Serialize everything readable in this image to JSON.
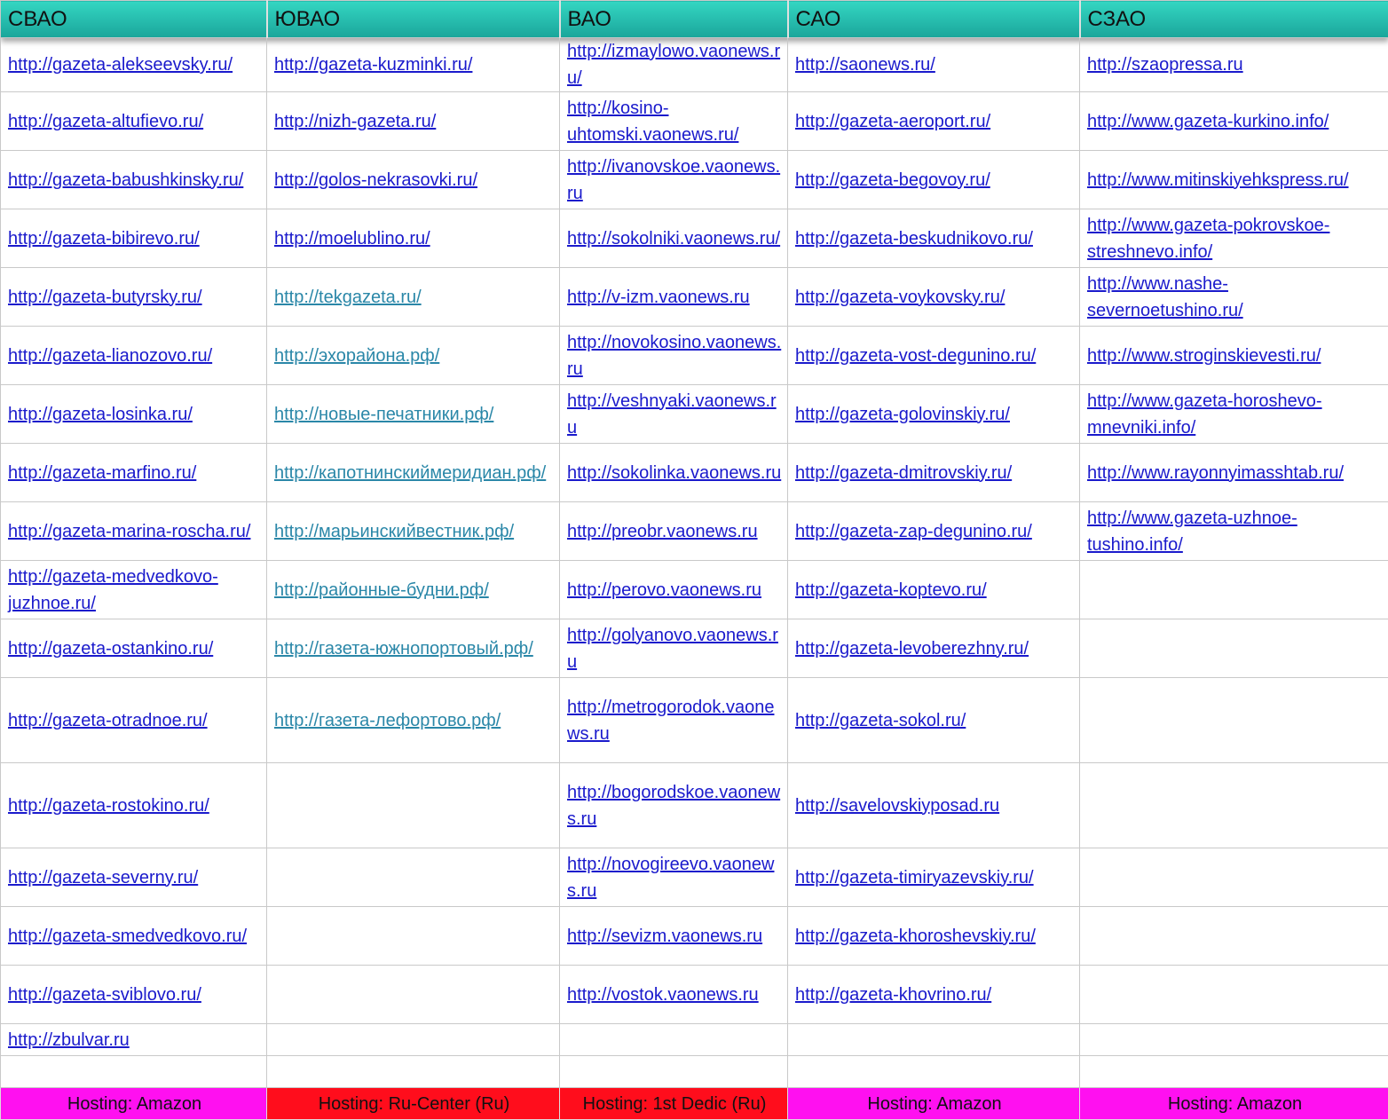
{
  "headers": [
    "СВАО",
    "ЮВАО",
    "ВАО",
    "САО",
    "СЗАО"
  ],
  "rows": [
    [
      "http://gazeta-alekseevsky.ru/",
      "http://gazeta-kuzminki.ru/",
      "http://izmaylowo.vaonews.ru/",
      "http://saonews.ru/",
      "http://szaopressa.ru"
    ],
    [
      "http://gazeta-altufievo.ru/",
      "http://nizh-gazeta.ru/",
      "http://kosino-uhtomski.vaonews.ru/",
      "http://gazeta-aeroport.ru/",
      "http://www.gazeta-kurkino.info/"
    ],
    [
      "http://gazeta-babushkinsky.ru/",
      "http://golos-nekrasovki.ru/",
      "http://ivanovskoe.vaonews.ru",
      "http://gazeta-begovoy.ru/",
      "http://www.mitinskiyehkspress.ru/"
    ],
    [
      "http://gazeta-bibirevo.ru/",
      "http://moelublino.ru/",
      "http://sokolniki.vaonews.ru/",
      "http://gazeta-beskudnikovo.ru/",
      "http://www.gazeta-pokrovskoe-streshnevo.info/"
    ],
    [
      "http://gazeta-butyrsky.ru/",
      "http://tekgazeta.ru/",
      "http://v-izm.vaonews.ru",
      "http://gazeta-voykovsky.ru/",
      "http://www.nashe-severnoetushino.ru/"
    ],
    [
      "http://gazeta-lianozovo.ru/",
      "http://эхорайона.рф/",
      "http://novokosino.vaonews.ru",
      "http://gazeta-vost-degunino.ru/",
      "http://www.stroginskievesti.ru/"
    ],
    [
      "http://gazeta-losinka.ru/",
      "http://новые-печатники.рф/",
      "http://veshnyaki.vaonews.ru",
      "http://gazeta-golovinskiy.ru/",
      "http://www.gazeta-horoshevo-mnevniki.info/"
    ],
    [
      "http://gazeta-marfino.ru/",
      "http://капотнинскиймеридиан.рф/",
      "http://sokolinka.vaonews.ru",
      "http://gazeta-dmitrovskiy.ru/",
      "http://www.rayonnyimasshtab.ru/"
    ],
    [
      "http://gazeta-marina-roscha.ru/",
      "http://марьинскийвестник.рф/",
      "http://preobr.vaonews.ru",
      "http://gazeta-zap-degunino.ru/",
      "http://www.gazeta-uzhnoe-tushino.info/"
    ],
    [
      "http://gazeta-medvedkovo-juzhnoe.ru/",
      "http://районные-будни.рф/",
      "http://perovo.vaonews.ru",
      "http://gazeta-koptevo.ru/",
      ""
    ],
    [
      "http://gazeta-ostankino.ru/",
      "http://газета-южнопортовый.рф/",
      "http://golyanovo.vaonews.ru",
      "http://gazeta-levoberezhny.ru/",
      ""
    ],
    [
      "http://gazeta-otradnoe.ru/",
      "http://газета-лефортово.рф/",
      "http://metrogorodok.vaonews.ru",
      "http://gazeta-sokol.ru/",
      ""
    ],
    [
      "http://gazeta-rostokino.ru/",
      "",
      "http://bogorodskoe.vaonews.ru",
      "http://savelovskiyposad.ru",
      ""
    ],
    [
      "http://gazeta-severny.ru/",
      "",
      "http://novogireevo.vaonews.ru",
      "http://gazeta-timiryazevskiy.ru/",
      ""
    ],
    [
      "http://gazeta-smedvedkovo.ru/",
      "",
      "http://sevizm.vaonews.ru",
      "http://gazeta-khoroshevskiy.ru/",
      ""
    ],
    [
      "http://gazeta-sviblovo.ru/",
      "",
      "http://vostok.vaonews.ru",
      "http://gazeta-khovrino.ru/",
      ""
    ],
    [
      "http://zbulvar.ru",
      "",
      "",
      "",
      ""
    ],
    [
      "",
      "",
      "",
      "",
      ""
    ]
  ],
  "hosting": [
    {
      "label": "Hosting: Amazon",
      "color": "#ff10f0"
    },
    {
      "label": "Hosting: Ru-Center (Ru)",
      "color": "#ff0d1c"
    },
    {
      "label": "Hosting: 1st Dedic (Ru)",
      "color": "#ff0d1c"
    },
    {
      "label": "Hosting: Amazon",
      "color": "#ff10f0"
    },
    {
      "label": "Hosting: Amazon",
      "color": "#ff10f0"
    }
  ]
}
